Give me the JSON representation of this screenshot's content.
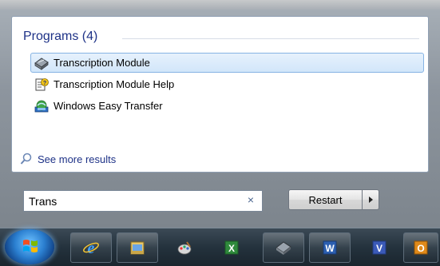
{
  "start_menu": {
    "group_header": "Programs (4)",
    "results": [
      {
        "label": "Transcription Module",
        "icon": "scanner-icon",
        "selected": true
      },
      {
        "label": "Transcription Module Help",
        "icon": "help-document-icon",
        "selected": false
      },
      {
        "label": "Windows Easy Transfer",
        "icon": "easy-transfer-icon",
        "selected": false
      }
    ],
    "see_more": "See more results",
    "search": {
      "value": "Trans",
      "clear_symbol": "×"
    },
    "power_button": "Restart"
  },
  "taskbar": {
    "items": [
      {
        "name": "internet-explorer",
        "icon": "internet-explorer-icon"
      },
      {
        "name": "file-explorer",
        "icon": "folder-icon"
      },
      {
        "name": "paint",
        "icon": "paint-icon"
      },
      {
        "name": "excel",
        "icon": "excel-icon"
      },
      {
        "name": "transcription-module",
        "icon": "scanner-icon"
      },
      {
        "name": "word",
        "icon": "word-icon"
      },
      {
        "name": "visio",
        "icon": "visio-icon"
      },
      {
        "name": "outlook",
        "icon": "outlook-icon"
      }
    ]
  },
  "colors": {
    "accent": "#1e3287",
    "selection": "#d2e6fa"
  }
}
